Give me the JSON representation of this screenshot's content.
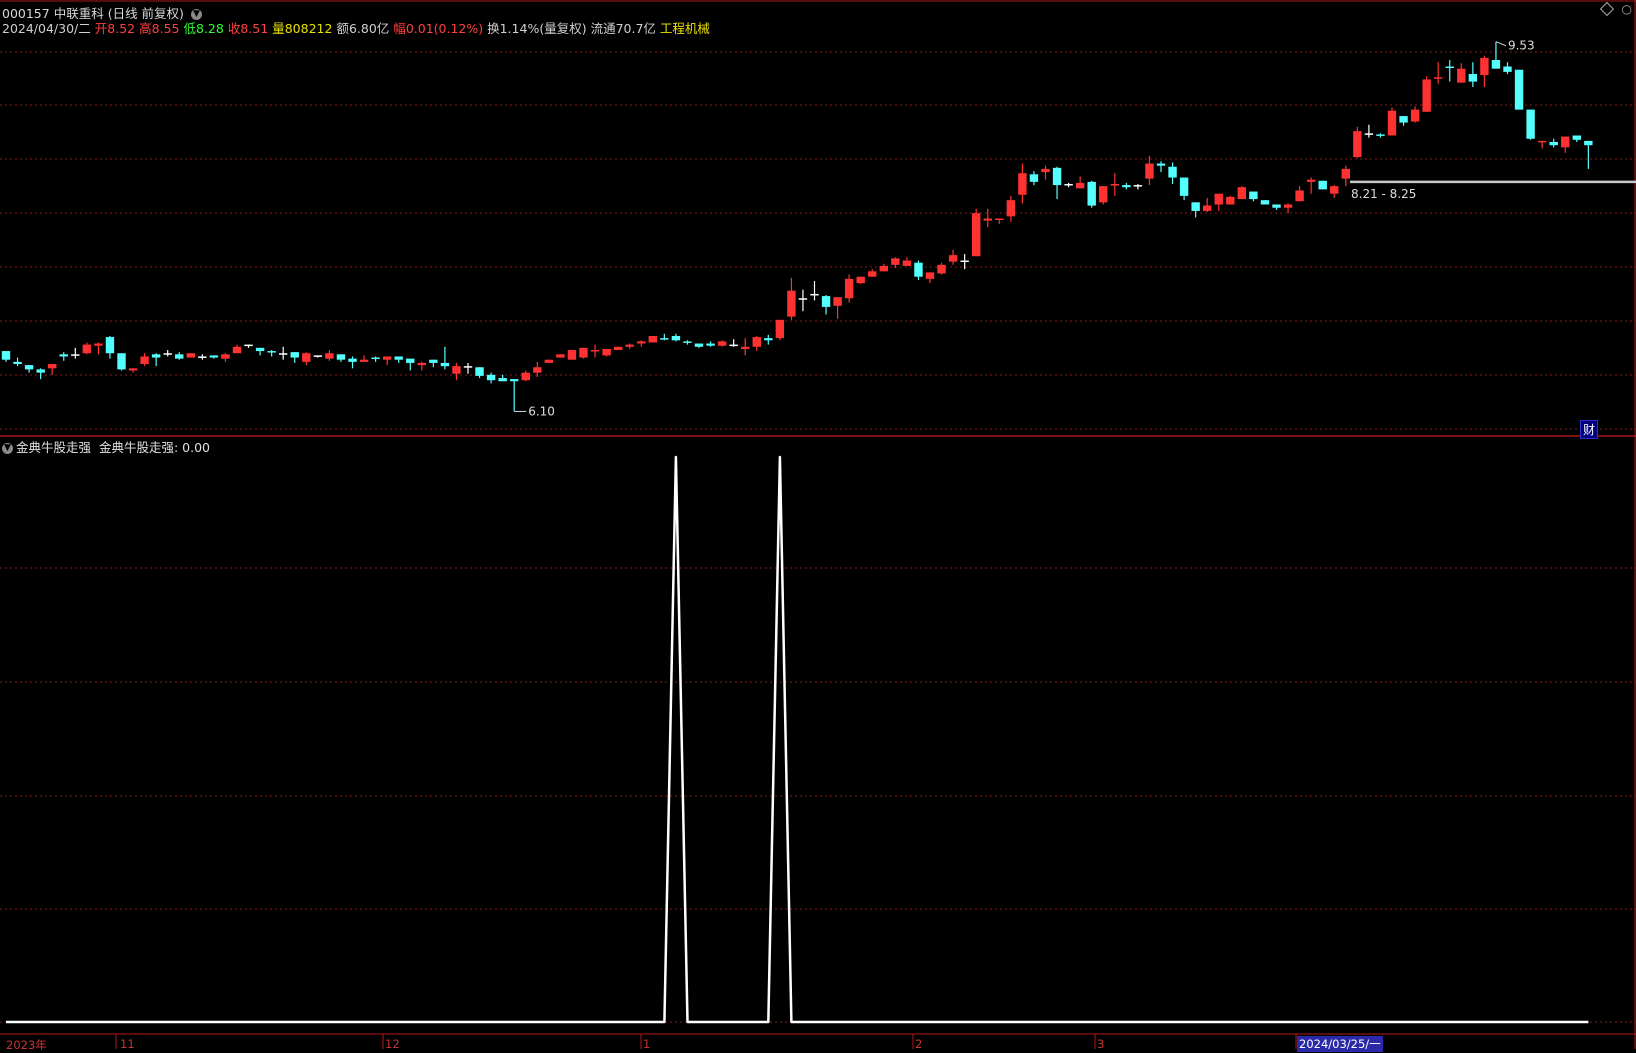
{
  "header": {
    "code": "000157",
    "name": "中联重科",
    "mode": "(日线 前复权)",
    "date": "2024/04/30/二",
    "open_label": "开",
    "open": "8.52",
    "high_label": "高",
    "high": "8.55",
    "low_label": "低",
    "low": "8.28",
    "close_label": "收",
    "close": "8.51",
    "vol_label": "量",
    "vol": "808212",
    "amt_label": "额",
    "amt": "6.80亿",
    "chg_label": "幅",
    "chg": "0.01(0.12%)",
    "turnover": "换1.14%(量复权)",
    "float": "流通70.7亿",
    "sector": "工程机械"
  },
  "indicator": {
    "name": "金典牛股走强",
    "line_label": "金典牛股走强",
    "value": ": 0.00"
  },
  "cai_label": "财",
  "colors": {
    "up": "#ff3232",
    "down": "#54ffff",
    "flat": "#ffffff",
    "grid": "#8b1a1a",
    "frame": "#b01818",
    "ind_line": "#ffffff"
  },
  "x_axis": {
    "labels": [
      "2023年",
      "11",
      "12",
      "1",
      "2",
      "3"
    ],
    "selected": "2024/03/25/一"
  },
  "chart_data": [
    {
      "type": "candlestick",
      "title": "000157 中联重科 (日线 前复权)",
      "ylim": [
        5.9,
        9.75
      ],
      "annotations": [
        {
          "text": "9.53",
          "kind": "max"
        },
        {
          "text": "6.10",
          "kind": "min"
        },
        {
          "text": "8.21 - 8.25",
          "kind": "range"
        }
      ],
      "ohlc": [
        [
          6.66,
          6.66,
          6.56,
          6.58
        ],
        [
          6.56,
          6.6,
          6.52,
          6.54
        ],
        [
          6.53,
          6.53,
          6.46,
          6.49
        ],
        [
          6.49,
          6.5,
          6.4,
          6.46
        ],
        [
          6.5,
          6.42,
          6.44,
          6.54
        ],
        [
          6.63,
          6.65,
          6.57,
          6.61
        ],
        [
          6.63,
          6.69,
          6.59,
          6.63
        ],
        [
          6.64,
          6.74,
          6.63,
          6.72
        ],
        [
          6.71,
          6.74,
          6.63,
          6.73
        ],
        [
          6.79,
          6.8,
          6.59,
          6.64
        ],
        [
          6.64,
          6.64,
          6.48,
          6.49
        ],
        [
          6.48,
          6.5,
          6.46,
          6.5
        ],
        [
          6.54,
          6.64,
          6.52,
          6.61
        ],
        [
          6.63,
          6.64,
          6.52,
          6.6
        ],
        [
          6.64,
          6.67,
          6.61,
          6.64
        ],
        [
          6.63,
          6.65,
          6.58,
          6.59
        ],
        [
          6.6,
          6.64,
          6.6,
          6.64
        ],
        [
          6.61,
          6.63,
          6.58,
          6.61
        ],
        [
          6.62,
          6.62,
          6.59,
          6.6
        ],
        [
          6.59,
          6.64,
          6.56,
          6.63
        ],
        [
          6.64,
          6.72,
          6.64,
          6.7
        ],
        [
          6.72,
          6.72,
          6.69,
          6.72
        ],
        [
          6.69,
          6.69,
          6.62,
          6.66
        ],
        [
          6.66,
          6.67,
          6.61,
          6.65
        ],
        [
          6.64,
          6.7,
          6.58,
          6.64
        ],
        [
          6.65,
          6.65,
          6.55,
          6.6
        ],
        [
          6.56,
          6.65,
          6.53,
          6.64
        ],
        [
          6.62,
          6.62,
          6.6,
          6.62
        ],
        [
          6.59,
          6.67,
          6.57,
          6.64
        ],
        [
          6.63,
          6.63,
          6.56,
          6.58
        ],
        [
          6.59,
          6.61,
          6.5,
          6.56
        ],
        [
          6.56,
          6.62,
          6.56,
          6.58
        ],
        [
          6.6,
          6.61,
          6.56,
          6.59
        ],
        [
          6.58,
          6.61,
          6.53,
          6.61
        ],
        [
          6.61,
          6.61,
          6.55,
          6.58
        ],
        [
          6.59,
          6.59,
          6.48,
          6.55
        ],
        [
          6.53,
          6.56,
          6.48,
          6.55
        ],
        [
          6.58,
          6.58,
          6.51,
          6.55
        ],
        [
          6.55,
          6.7,
          6.49,
          6.52
        ],
        [
          6.45,
          6.55,
          6.39,
          6.52
        ],
        [
          6.52,
          6.55,
          6.45,
          6.52
        ],
        [
          6.51,
          6.51,
          6.41,
          6.43
        ],
        [
          6.44,
          6.46,
          6.36,
          6.39
        ],
        [
          6.41,
          6.44,
          6.38,
          6.38
        ],
        [
          6.4,
          6.4,
          6.1,
          6.38
        ],
        [
          6.39,
          6.48,
          6.38,
          6.46
        ],
        [
          6.46,
          6.56,
          6.42,
          6.51
        ],
        [
          6.55,
          6.58,
          6.55,
          6.58
        ],
        [
          6.6,
          6.63,
          6.6,
          6.63
        ],
        [
          6.58,
          6.65,
          6.58,
          6.67
        ],
        [
          6.6,
          6.65,
          6.59,
          6.69
        ],
        [
          6.66,
          6.72,
          6.6,
          6.67
        ],
        [
          6.62,
          6.68,
          6.61,
          6.68
        ],
        [
          6.67,
          6.7,
          6.67,
          6.7
        ],
        [
          6.7,
          6.73,
          6.68,
          6.72
        ],
        [
          6.73,
          6.76,
          6.7,
          6.75
        ],
        [
          6.74,
          6.8,
          6.74,
          6.8
        ],
        [
          6.78,
          6.82,
          6.76,
          6.77
        ],
        [
          6.8,
          6.82,
          6.75,
          6.76
        ],
        [
          6.75,
          6.76,
          6.72,
          6.74
        ],
        [
          6.73,
          6.73,
          6.69,
          6.7
        ],
        [
          6.73,
          6.75,
          6.7,
          6.71
        ],
        [
          6.71,
          6.76,
          6.7,
          6.75
        ],
        [
          6.72,
          6.77,
          6.7,
          6.72
        ],
        [
          6.68,
          6.78,
          6.62,
          6.7
        ],
        [
          6.7,
          6.8,
          6.66,
          6.79
        ],
        [
          6.78,
          6.81,
          6.72,
          6.76
        ],
        [
          6.78,
          6.95,
          6.76,
          6.95
        ],
        [
          6.98,
          7.34,
          6.95,
          7.22
        ],
        [
          7.15,
          7.23,
          7.03,
          7.15
        ],
        [
          7.19,
          7.31,
          7.13,
          7.19
        ],
        [
          7.17,
          7.18,
          7.0,
          7.07
        ],
        [
          7.08,
          7.15,
          6.96,
          7.16
        ],
        [
          7.15,
          7.37,
          7.11,
          7.33
        ],
        [
          7.29,
          7.35,
          7.28,
          7.35
        ],
        [
          7.35,
          7.42,
          7.35,
          7.4
        ],
        [
          7.4,
          7.47,
          7.4,
          7.45
        ],
        [
          7.46,
          7.53,
          7.43,
          7.52
        ],
        [
          7.45,
          7.53,
          7.45,
          7.5
        ],
        [
          7.48,
          7.5,
          7.32,
          7.35
        ],
        [
          7.33,
          7.39,
          7.29,
          7.39
        ],
        [
          7.38,
          7.48,
          7.37,
          7.46
        ],
        [
          7.49,
          7.6,
          7.46,
          7.55
        ],
        [
          7.5,
          7.56,
          7.42,
          7.5
        ],
        [
          7.54,
          7.98,
          7.54,
          7.94
        ],
        [
          7.87,
          7.98,
          7.81,
          7.89
        ],
        [
          7.88,
          7.89,
          7.84,
          7.89
        ],
        [
          7.91,
          8.1,
          7.86,
          8.06
        ],
        [
          8.11,
          8.4,
          8.03,
          8.31
        ],
        [
          8.3,
          8.33,
          8.2,
          8.23
        ],
        [
          8.32,
          8.38,
          8.25,
          8.35
        ],
        [
          8.36,
          8.37,
          8.07,
          8.2
        ],
        [
          8.21,
          8.22,
          8.18,
          8.21
        ],
        [
          8.17,
          8.28,
          8.17,
          8.22
        ],
        [
          8.23,
          8.24,
          7.99,
          8.01
        ],
        [
          8.04,
          8.19,
          8.02,
          8.19
        ],
        [
          8.2,
          8.31,
          8.1,
          8.21
        ],
        [
          8.2,
          8.22,
          8.16,
          8.18
        ],
        [
          8.2,
          8.21,
          8.16,
          8.2
        ],
        [
          8.26,
          8.47,
          8.2,
          8.4
        ],
        [
          8.4,
          8.42,
          8.32,
          8.38
        ],
        [
          8.37,
          8.41,
          8.21,
          8.27
        ],
        [
          8.27,
          8.27,
          8.06,
          8.1
        ],
        [
          8.04,
          8.04,
          7.9,
          7.96
        ],
        [
          7.96,
          8.08,
          7.95,
          8.01
        ],
        [
          8.02,
          8.11,
          7.96,
          8.12
        ],
        [
          8.02,
          8.1,
          8.03,
          8.09
        ],
        [
          8.07,
          8.19,
          8.07,
          8.18
        ],
        [
          8.14,
          8.14,
          8.05,
          8.07
        ],
        [
          8.06,
          8.06,
          8.03,
          8.02
        ],
        [
          8.02,
          8.02,
          7.97,
          7.99
        ],
        [
          7.99,
          8.03,
          7.94,
          8.02
        ],
        [
          8.05,
          8.19,
          8.05,
          8.15
        ],
        [
          8.23,
          8.27,
          8.12,
          8.25
        ],
        [
          8.24,
          8.24,
          8.17,
          8.16
        ],
        [
          8.12,
          8.2,
          8.08,
          8.19
        ],
        [
          8.26,
          8.38,
          8.19,
          8.35
        ],
        [
          8.46,
          8.74,
          8.45,
          8.7
        ],
        [
          8.68,
          8.76,
          8.64,
          8.68
        ],
        [
          8.67,
          8.68,
          8.64,
          8.66
        ],
        [
          8.66,
          8.92,
          8.66,
          8.89
        ],
        [
          8.84,
          8.84,
          8.75,
          8.78
        ],
        [
          8.79,
          8.93,
          8.78,
          8.9
        ],
        [
          8.88,
          9.21,
          8.88,
          9.18
        ],
        [
          9.19,
          9.34,
          9.14,
          9.2
        ],
        [
          9.3,
          9.36,
          9.16,
          9.29
        ],
        [
          9.15,
          9.33,
          9.2,
          9.28
        ],
        [
          9.23,
          9.34,
          9.11,
          9.16
        ],
        [
          9.22,
          9.4,
          9.11,
          9.38
        ],
        [
          9.36,
          9.53,
          9.31,
          9.28
        ],
        [
          9.3,
          9.34,
          9.23,
          9.25
        ],
        [
          9.27,
          9.27,
          8.95,
          8.9
        ],
        [
          8.9,
          8.9,
          8.62,
          8.63
        ],
        [
          8.6,
          8.61,
          8.54,
          8.61
        ],
        [
          8.6,
          8.63,
          8.55,
          8.57
        ],
        [
          8.55,
          8.65,
          8.5,
          8.65
        ],
        [
          8.66,
          8.66,
          8.6,
          8.62
        ],
        [
          8.61,
          8.61,
          8.35,
          8.57
        ]
      ]
    },
    {
      "type": "line",
      "title": "金典牛股走强",
      "ylim": [
        0,
        1
      ],
      "signal_days": [
        58,
        67
      ],
      "length": 138,
      "last_value": 0.0
    }
  ]
}
